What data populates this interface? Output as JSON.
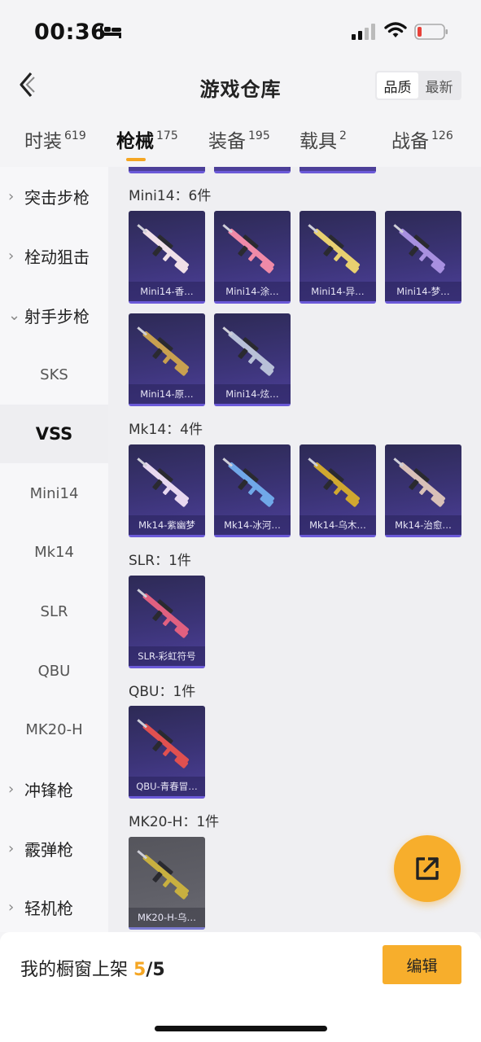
{
  "status": {
    "time": "00:36"
  },
  "header": {
    "title": "游戏仓库",
    "sort_options": [
      "品质",
      "最新"
    ],
    "sort_active": 0
  },
  "tabs": [
    {
      "label": "时装",
      "count": "619"
    },
    {
      "label": "枪械",
      "count": "175"
    },
    {
      "label": "装备",
      "count": "195"
    },
    {
      "label": "载具",
      "count": "2"
    },
    {
      "label": "战备",
      "count": "126"
    }
  ],
  "sidebar": {
    "items": [
      {
        "label": "突击步枪",
        "kind": "group",
        "expanded": false
      },
      {
        "label": "栓动狙击",
        "kind": "group",
        "expanded": false
      },
      {
        "label": "射手步枪",
        "kind": "group",
        "expanded": true
      },
      {
        "label": "SKS",
        "kind": "sub"
      },
      {
        "label": "VSS",
        "kind": "sub",
        "selected": true
      },
      {
        "label": "Mini14",
        "kind": "sub"
      },
      {
        "label": "Mk14",
        "kind": "sub"
      },
      {
        "label": "SLR",
        "kind": "sub"
      },
      {
        "label": "QBU",
        "kind": "sub"
      },
      {
        "label": "MK20-H",
        "kind": "sub"
      },
      {
        "label": "冲锋枪",
        "kind": "group",
        "expanded": false
      },
      {
        "label": "霰弹枪",
        "kind": "group",
        "expanded": false
      },
      {
        "label": "轻机枪",
        "kind": "group",
        "expanded": false
      }
    ]
  },
  "groups": [
    {
      "label": "Mini14：6件",
      "items": [
        {
          "name": "Mini14-香…",
          "color": "#f0e0e8"
        },
        {
          "name": "Mini14-涂…",
          "color": "#f08aa8"
        },
        {
          "name": "Mini14-异…",
          "color": "#e8d070"
        },
        {
          "name": "Mini14-梦…",
          "color": "#a890e0"
        },
        {
          "name": "Mini14-原…",
          "color": "#c8a050"
        },
        {
          "name": "Mini14-炫…",
          "color": "#b8c0d8"
        }
      ]
    },
    {
      "label": "Mk14：4件",
      "items": [
        {
          "name": "Mk14-紫幽梦",
          "color": "#e8d8f0"
        },
        {
          "name": "Mk14-冰河…",
          "color": "#70a8e8"
        },
        {
          "name": "Mk14-乌木…",
          "color": "#d0a830"
        },
        {
          "name": "Mk14-治愈…",
          "color": "#d8c0b8"
        }
      ]
    },
    {
      "label": "SLR：1件",
      "items": [
        {
          "name": "SLR-彩虹符号",
          "color": "#e06080"
        }
      ]
    },
    {
      "label": "QBU：1件",
      "items": [
        {
          "name": "QBU-青春冒…",
          "color": "#e05050"
        }
      ]
    },
    {
      "label": "MK20-H：1件",
      "items": [
        {
          "name": "MK20-H-乌…",
          "color": "#c8b040",
          "gray": true
        }
      ]
    }
  ],
  "bottom": {
    "prefix": "我的橱窗上架",
    "count": "5",
    "sep": "/",
    "total": "5",
    "edit_label": "编辑"
  },
  "colors": {
    "accent": "#f5a623",
    "card_bg": "#3c3478",
    "card_border": "#6b5ad8"
  }
}
